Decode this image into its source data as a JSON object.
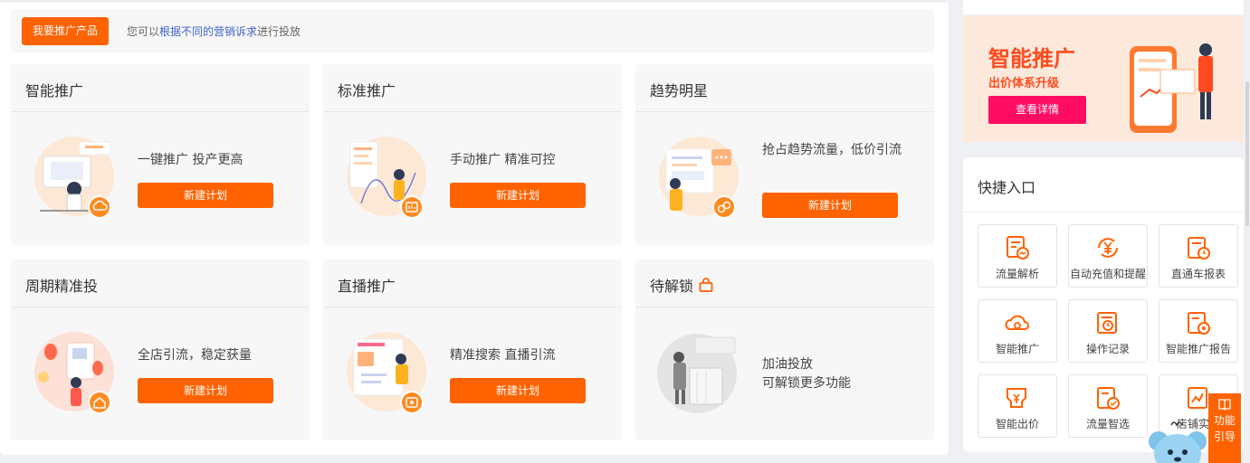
{
  "promo": {
    "button_label": "我要推广产品",
    "text_before": "您可以",
    "link_text": "根据不同的营销诉求",
    "text_after": "进行投放"
  },
  "cards": [
    {
      "title": "智能推广",
      "desc": "一键推广 投产更高",
      "button": "新建计划",
      "icon": "cloud-icon"
    },
    {
      "title": "标准推广",
      "desc": "手动推广 精准可控",
      "button": "新建计划",
      "icon": "chart-icon"
    },
    {
      "title": "趋势明星",
      "desc": "抢占趋势流量，低价引流",
      "button": "新建计划",
      "icon": "coins-icon"
    },
    {
      "title": "周期精准投",
      "desc": "全店引流，稳定获量",
      "button": "新建计划",
      "icon": "home-icon"
    },
    {
      "title": "直播推广",
      "desc": "精准搜索 直播引流",
      "button": "新建计划",
      "icon": "live-icon"
    },
    {
      "title": "待解锁",
      "desc_line1": "加油投放",
      "desc_line2": "可解锁更多功能",
      "icon": "lock-icon"
    }
  ],
  "banner": {
    "title": "智能推广",
    "subtitle": "出价体系升级",
    "button": "查看详情"
  },
  "quick": {
    "title": "快捷入口",
    "items": [
      {
        "label": "流量解析",
        "icon": "traffic-analysis-icon"
      },
      {
        "label": "自动充值和提醒",
        "icon": "yuan-refresh-icon"
      },
      {
        "label": "直通车报表",
        "icon": "report-clock-icon"
      },
      {
        "label": "智能推广",
        "icon": "cloud-icon"
      },
      {
        "label": "操作记录",
        "icon": "record-clock-icon"
      },
      {
        "label": "智能推广报告",
        "icon": "smart-report-icon"
      },
      {
        "label": "智能出价",
        "icon": "bid-icon"
      },
      {
        "label": "流量智选",
        "icon": "traffic-select-icon"
      },
      {
        "label": "店铺实时",
        "icon": "store-realtime-icon"
      }
    ]
  },
  "guide": {
    "line1": "功能",
    "line2": "引导"
  },
  "colors": {
    "accent": "#ff6200",
    "banner_accent": "#ff4b1f",
    "banner_button": "#ff0d63",
    "link": "#3d63c9"
  }
}
